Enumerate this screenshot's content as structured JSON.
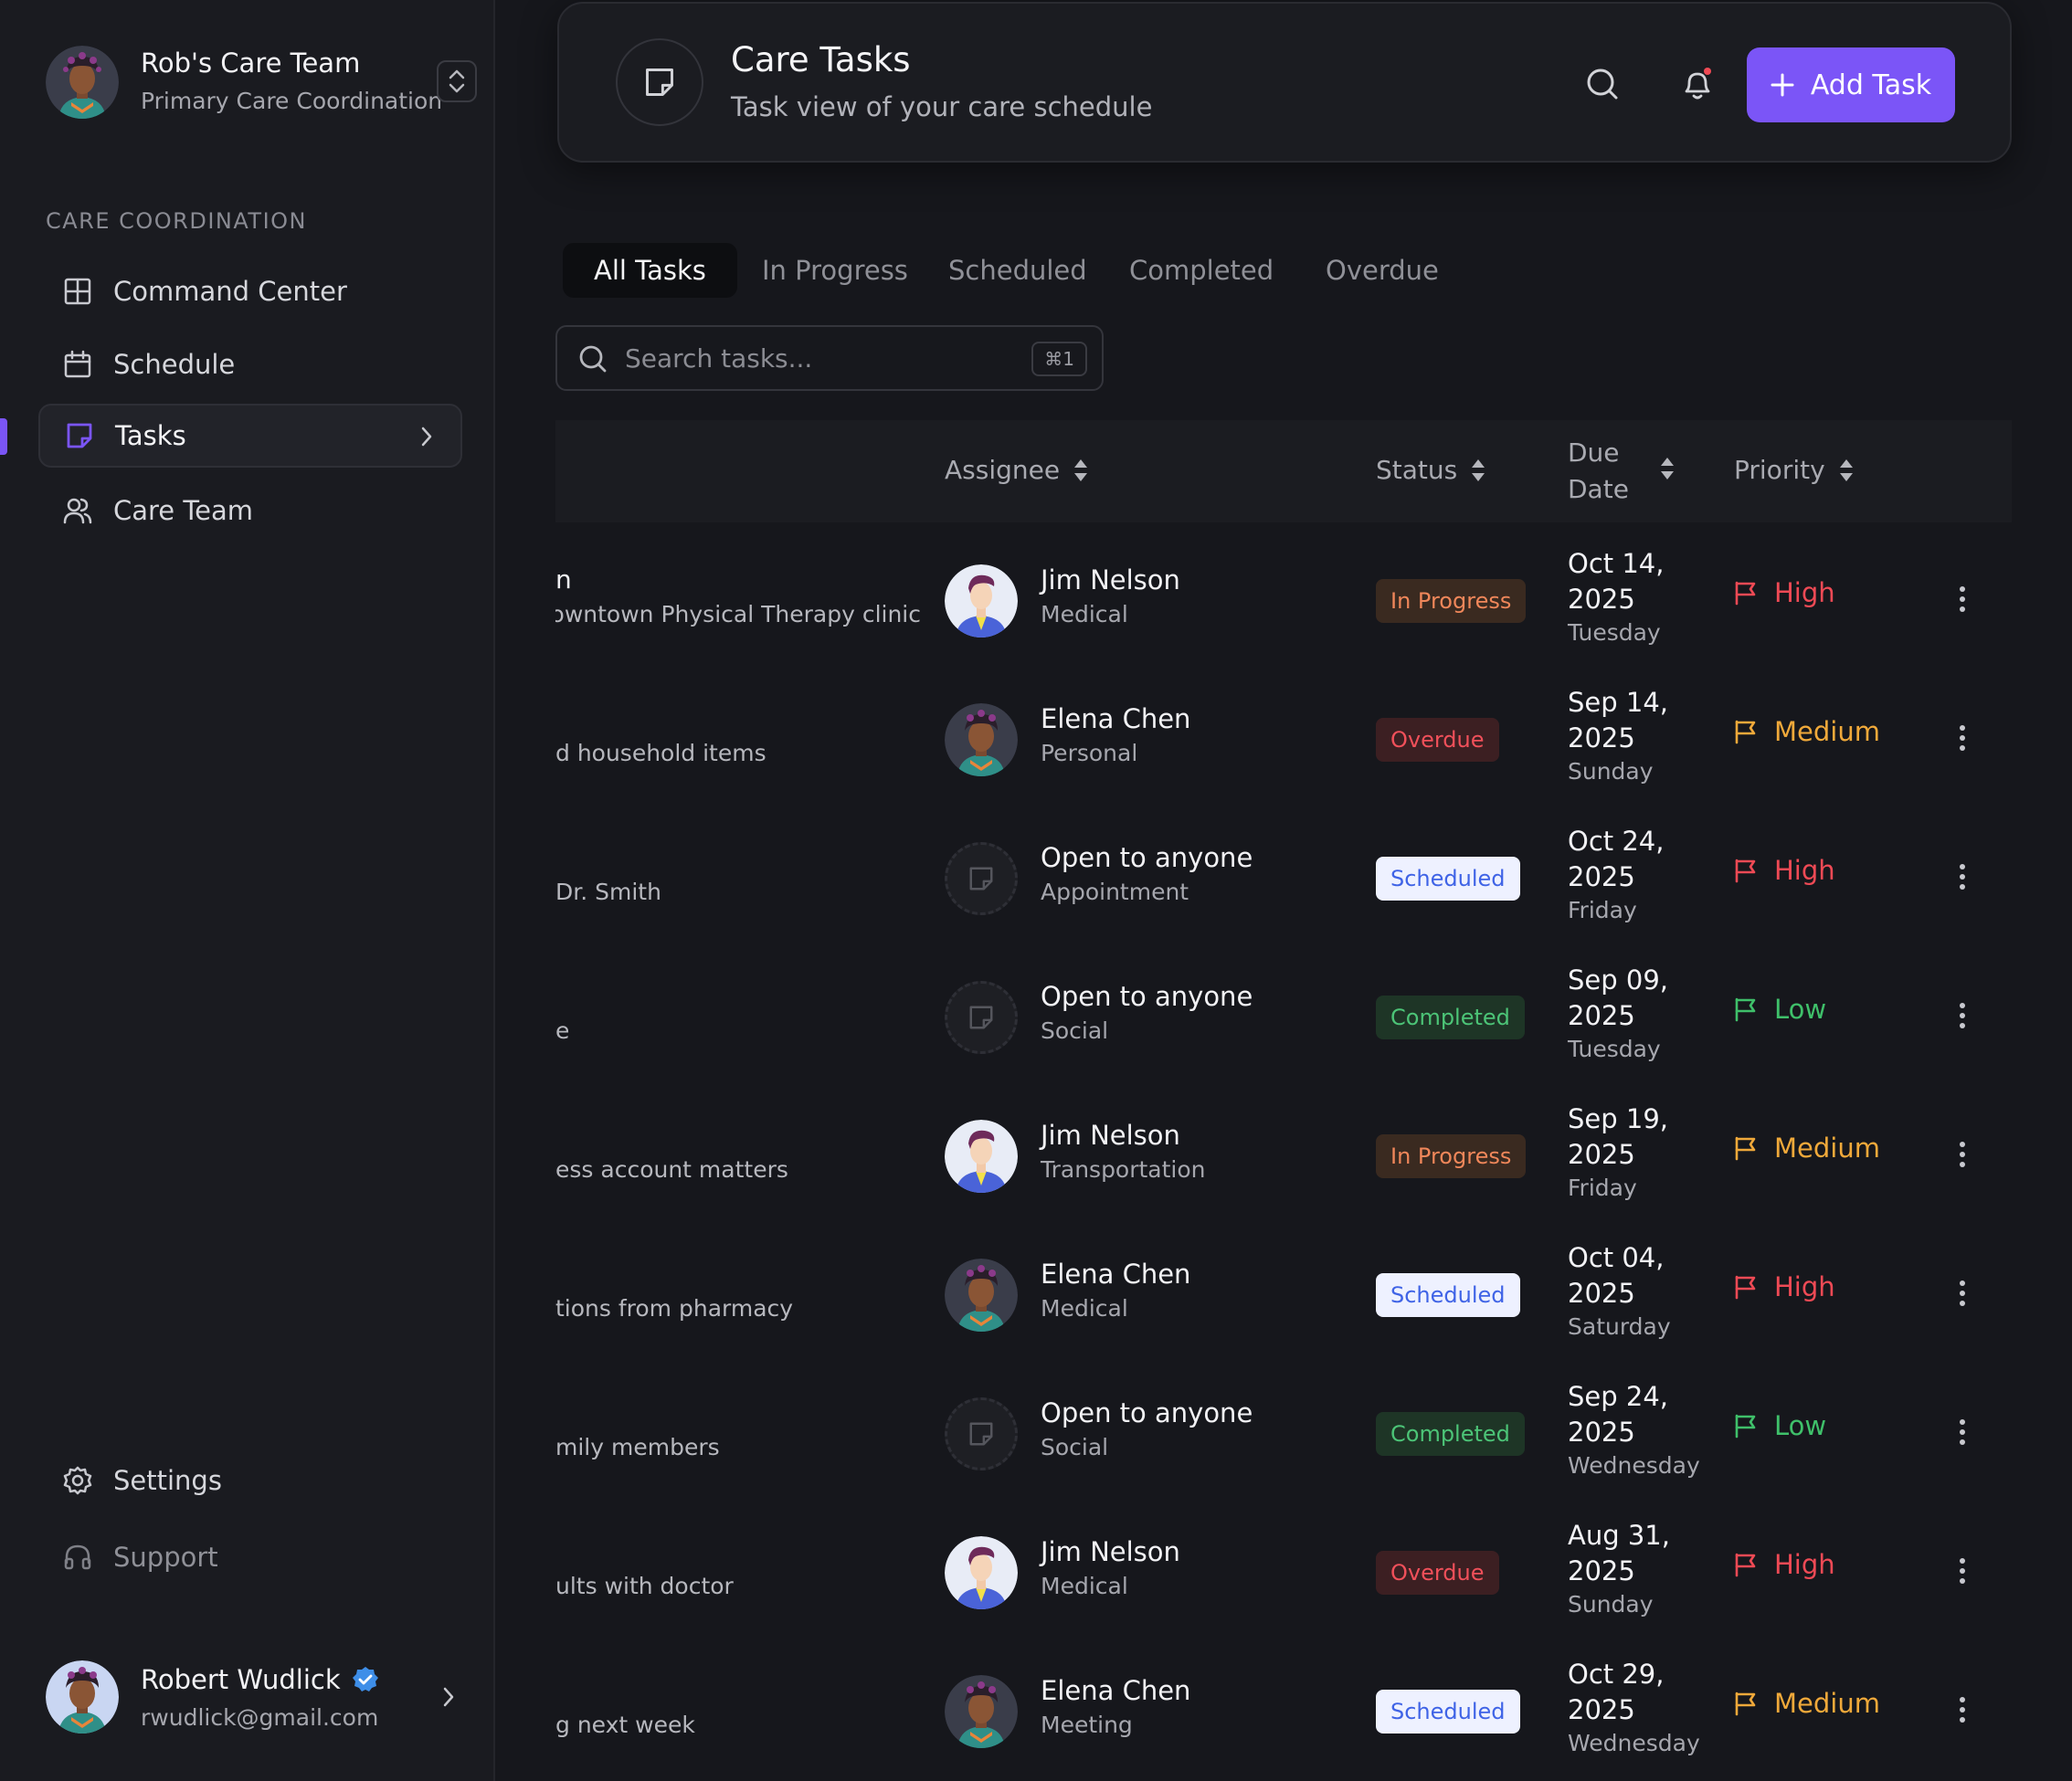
{
  "sidebar": {
    "team_name": "Rob's Care Team",
    "team_sub": "Primary Care Coordination",
    "section_label": "CARE COORDINATION",
    "nav": [
      {
        "label": "Command Center",
        "icon": "grid-icon"
      },
      {
        "label": "Schedule",
        "icon": "calendar-icon"
      },
      {
        "label": "Tasks",
        "icon": "note-icon",
        "active": true
      },
      {
        "label": "Care Team",
        "icon": "users-icon"
      }
    ],
    "settings_label": "Settings",
    "support_label": "Support",
    "user": {
      "name": "Robert Wudlick",
      "email": "rwudlick@gmail.com"
    }
  },
  "header": {
    "title": "Care Tasks",
    "subtitle": "Task view of your care schedule",
    "add_label": "Add Task"
  },
  "tabs": [
    "All Tasks",
    "In Progress",
    "Scheduled",
    "Completed",
    "Overdue"
  ],
  "search": {
    "placeholder": "Search tasks...",
    "shortcut": "⌘1"
  },
  "table": {
    "headers": {
      "assignee": "Assignee",
      "status": "Status",
      "due_line1": "Due",
      "due_line2": "Date",
      "priority": "Priority"
    },
    "rows": [
      {
        "title": "n",
        "desc": "Downtown Physical Therapy clinic",
        "assignee": "Jim Nelson",
        "category": "Medical",
        "status": "In Progress",
        "due": "Oct 14, 2025",
        "day": "Tuesday",
        "priority": "High"
      },
      {
        "title": "",
        "desc": "d household items",
        "assignee": "Elena Chen",
        "category": "Personal",
        "status": "Overdue",
        "due": "Sep 14, 2025",
        "day": "Sunday",
        "priority": "Medium"
      },
      {
        "title": "",
        "desc": "Dr. Smith",
        "assignee": "Open to anyone",
        "category": "Appointment",
        "status": "Scheduled",
        "due": "Oct 24, 2025",
        "day": "Friday",
        "priority": "High"
      },
      {
        "title": "",
        "desc": "e",
        "assignee": "Open to anyone",
        "category": "Social",
        "status": "Completed",
        "due": "Sep 09, 2025",
        "day": "Tuesday",
        "priority": "Low"
      },
      {
        "title": "",
        "desc": "ess account matters",
        "assignee": "Jim Nelson",
        "category": "Transportation",
        "status": "In Progress",
        "due": "Sep 19, 2025",
        "day": "Friday",
        "priority": "Medium"
      },
      {
        "title": "",
        "desc": "tions from pharmacy",
        "assignee": "Elena Chen",
        "category": "Medical",
        "status": "Scheduled",
        "due": "Oct 04, 2025",
        "day": "Saturday",
        "priority": "High"
      },
      {
        "title": "",
        "desc": "mily members",
        "assignee": "Open to anyone",
        "category": "Social",
        "status": "Completed",
        "due": "Sep 24, 2025",
        "day": "Wednesday",
        "priority": "Low"
      },
      {
        "title": "",
        "desc": "ults with doctor",
        "assignee": "Jim Nelson",
        "category": "Medical",
        "status": "Overdue",
        "due": "Aug 31, 2025",
        "day": "Sunday",
        "priority": "High"
      },
      {
        "title": "",
        "desc": "g next week",
        "assignee": "Elena Chen",
        "category": "Meeting",
        "status": "Scheduled",
        "due": "Oct 29, 2025",
        "day": "Wednesday",
        "priority": "Medium"
      }
    ]
  },
  "colors": {
    "accent": "#7b55f7",
    "high": "#ef4a55",
    "medium": "#f0a93a",
    "low": "#3fc06a"
  }
}
